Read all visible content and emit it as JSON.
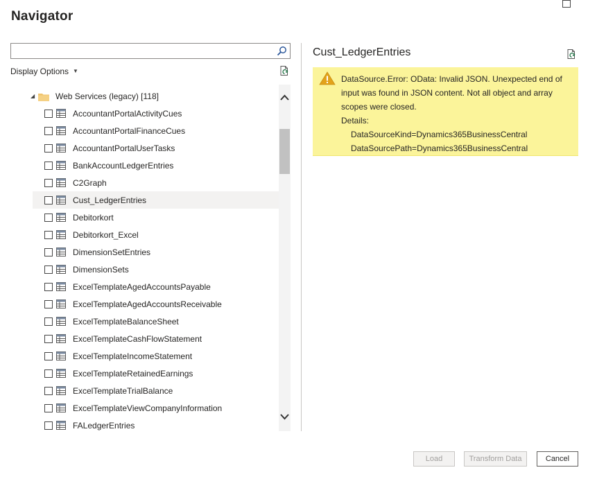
{
  "window": {
    "title": "Navigator"
  },
  "search": {
    "value": "",
    "placeholder": ""
  },
  "display_options": {
    "label": "Display Options"
  },
  "tree": {
    "folder": {
      "label": "Web Services (legacy) [118]",
      "expanded": true
    },
    "items": [
      {
        "label": "AccountantPortalActivityCues",
        "checked": false,
        "selected": false
      },
      {
        "label": "AccountantPortalFinanceCues",
        "checked": false,
        "selected": false
      },
      {
        "label": "AccountantPortalUserTasks",
        "checked": false,
        "selected": false
      },
      {
        "label": "BankAccountLedgerEntries",
        "checked": false,
        "selected": false
      },
      {
        "label": "C2Graph",
        "checked": false,
        "selected": false
      },
      {
        "label": "Cust_LedgerEntries",
        "checked": false,
        "selected": true
      },
      {
        "label": "Debitorkort",
        "checked": false,
        "selected": false
      },
      {
        "label": "Debitorkort_Excel",
        "checked": false,
        "selected": false
      },
      {
        "label": "DimensionSetEntries",
        "checked": false,
        "selected": false
      },
      {
        "label": "DimensionSets",
        "checked": false,
        "selected": false
      },
      {
        "label": "ExcelTemplateAgedAccountsPayable",
        "checked": false,
        "selected": false
      },
      {
        "label": "ExcelTemplateAgedAccountsReceivable",
        "checked": false,
        "selected": false
      },
      {
        "label": "ExcelTemplateBalanceSheet",
        "checked": false,
        "selected": false
      },
      {
        "label": "ExcelTemplateCashFlowStatement",
        "checked": false,
        "selected": false
      },
      {
        "label": "ExcelTemplateIncomeStatement",
        "checked": false,
        "selected": false
      },
      {
        "label": "ExcelTemplateRetainedEarnings",
        "checked": false,
        "selected": false
      },
      {
        "label": "ExcelTemplateTrialBalance",
        "checked": false,
        "selected": false
      },
      {
        "label": "ExcelTemplateViewCompanyInformation",
        "checked": false,
        "selected": false
      },
      {
        "label": "FALedgerEntries",
        "checked": false,
        "selected": false
      }
    ]
  },
  "preview": {
    "title": "Cust_LedgerEntries",
    "error": {
      "message": "DataSource.Error: OData: Invalid JSON. Unexpected end of input was found in JSON content. Not all object and array scopes were closed.",
      "details_label": "Details:",
      "details": [
        "DataSourceKind=Dynamics365BusinessCentral",
        "DataSourcePath=Dynamics365BusinessCentral"
      ]
    }
  },
  "buttons": {
    "load": "Load",
    "transform": "Transform Data",
    "cancel": "Cancel"
  },
  "colors": {
    "error_bg": "#fbf49a",
    "selected_row": "#f3f2f1",
    "warning": "#e3a21a"
  },
  "icons": {
    "search": "search-icon",
    "refresh": "refresh-icon",
    "folder": "folder-icon",
    "table": "table-icon",
    "warning": "warning-icon",
    "maximize": "maximize-icon"
  }
}
